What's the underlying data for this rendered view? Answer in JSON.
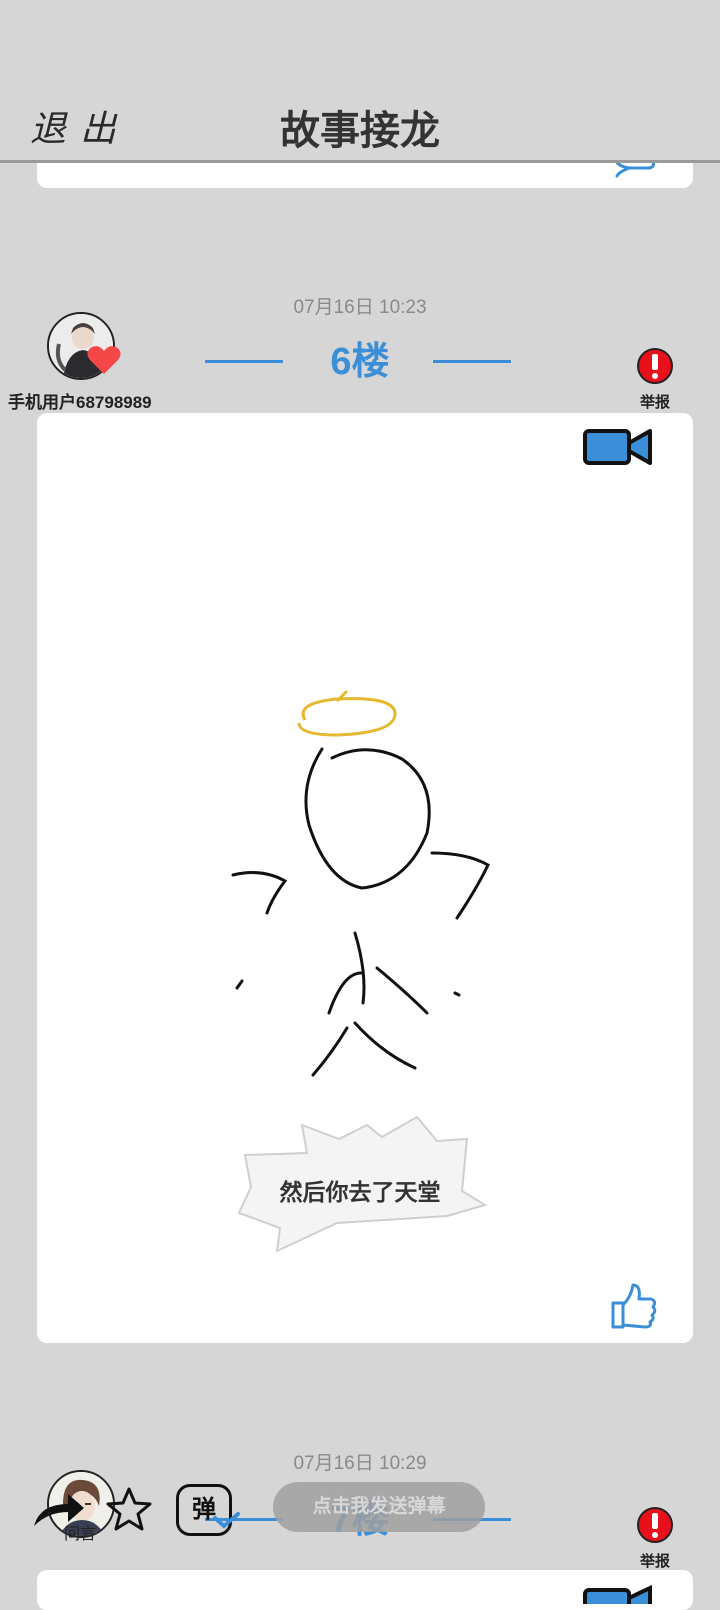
{
  "header": {
    "exit_label": "退出",
    "title": "故事接龙"
  },
  "posts": [
    {
      "timestamp": "07月16日  10:23",
      "floor": "6楼",
      "username": "手机用户68798989",
      "report_label": "举报",
      "caption": "然后你去了天堂"
    },
    {
      "timestamp": "07月16日  10:29",
      "floor": "7楼",
      "report_label": "举报"
    }
  ],
  "bottom_bar": {
    "reply_label": "间言",
    "danmaku_icon_text": "弹",
    "danmaku_placeholder": "点击我发送弹幕"
  },
  "colors": {
    "accent": "#3a8fd8",
    "background": "#d6d6d6",
    "report_red": "#e8101a",
    "heart_red": "#f44848",
    "halo_yellow": "#e5b830"
  },
  "icons": [
    "thumbs-up-icon",
    "video-camera-icon",
    "report-icon",
    "heart-icon",
    "share-arrow-icon",
    "star-icon",
    "danmaku-icon"
  ]
}
